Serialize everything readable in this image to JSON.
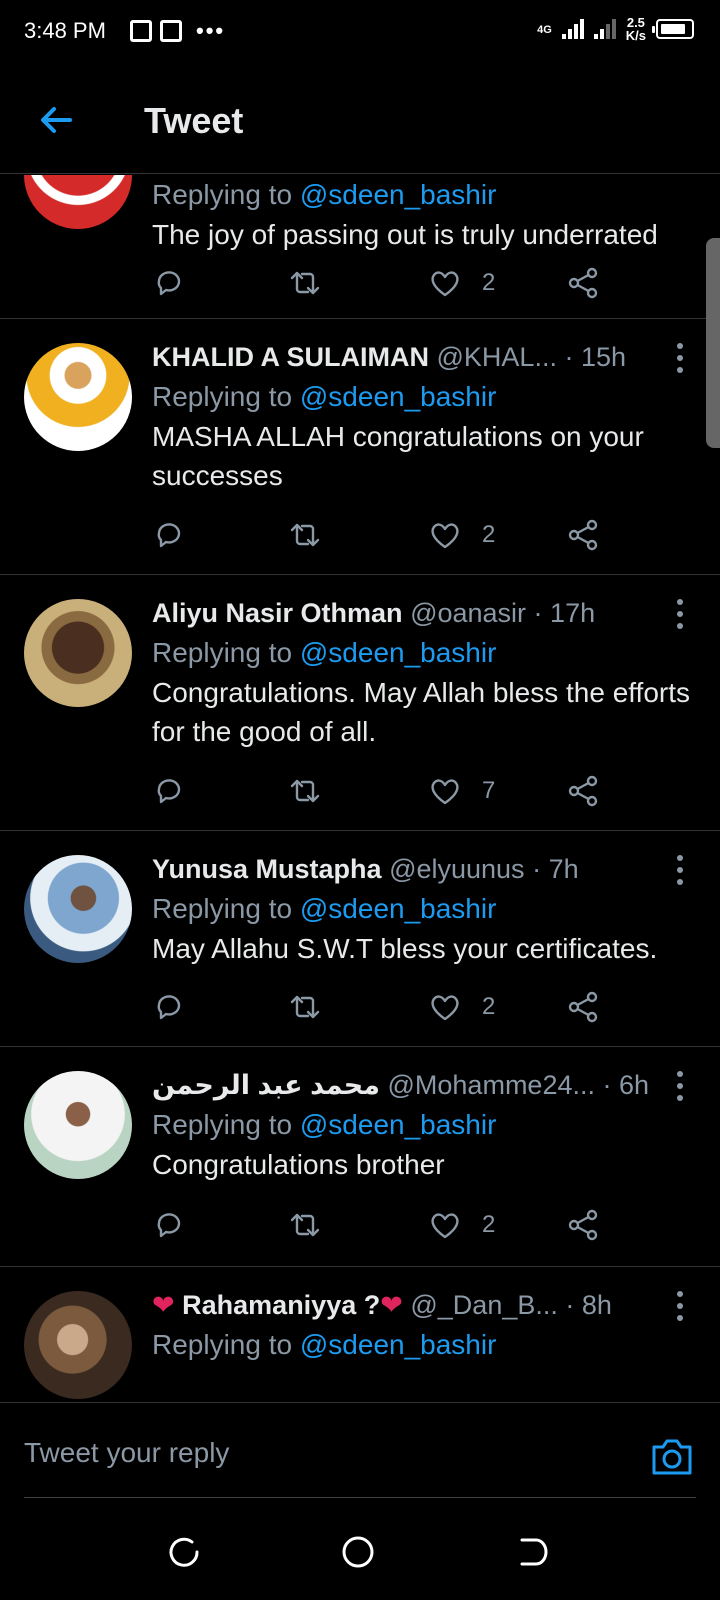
{
  "status_bar": {
    "time": "3:48 PM",
    "network_type": "4G",
    "speed_value": "2.5",
    "speed_unit": "K/s"
  },
  "header": {
    "title": "Tweet",
    "back_icon": "arrow-left-icon"
  },
  "colors": {
    "accent": "#1d9bf0",
    "background": "#000000",
    "muted": "#8b98a5",
    "divider": "#2f3336",
    "heart_red": "#e0245e"
  },
  "replies": [
    {
      "name": "",
      "handle": "",
      "time": "",
      "replying_label": "Replying to",
      "replying_to": "@sdeen_bashir",
      "text": "The joy of passing out is truly underrated",
      "likes": "2"
    },
    {
      "name": "KHALID A SULAIMAN",
      "handle": "@KHAL...",
      "time": "15h",
      "replying_label": "Replying to",
      "replying_to": "@sdeen_bashir",
      "text": "MASHA ALLAH congratulations on your successes",
      "likes": "2"
    },
    {
      "name": "Aliyu Nasir Othman",
      "handle": "@oanasir",
      "time": "17h",
      "replying_label": "Replying to",
      "replying_to": "@sdeen_bashir",
      "text": "Congratulations. May Allah bless the efforts for the good of all.",
      "likes": "7"
    },
    {
      "name": "Yunusa Mustapha",
      "handle": "@elyuunus",
      "time": "7h",
      "replying_label": "Replying to",
      "replying_to": "@sdeen_bashir",
      "text": "May Allahu S.W.T bless your certificates.",
      "likes": "2"
    },
    {
      "name": "محمد عبد الرحمن",
      "handle": "@Mohamme24...",
      "time": "6h",
      "replying_label": "Replying to",
      "replying_to": "@sdeen_bashir",
      "text": "Congratulations brother",
      "likes": "2"
    },
    {
      "name": "Rahamaniyya ?",
      "handle": "@_Dan_B...",
      "time": "8h",
      "replying_label": "Replying to",
      "replying_to": "@sdeen_bashir",
      "text": "",
      "likes": ""
    }
  ],
  "reply_bar": {
    "placeholder": "Tweet your reply",
    "camera_icon": "camera-icon"
  },
  "nav_bar": {
    "icons": [
      "recents-icon",
      "home-icon",
      "back-icon"
    ]
  }
}
